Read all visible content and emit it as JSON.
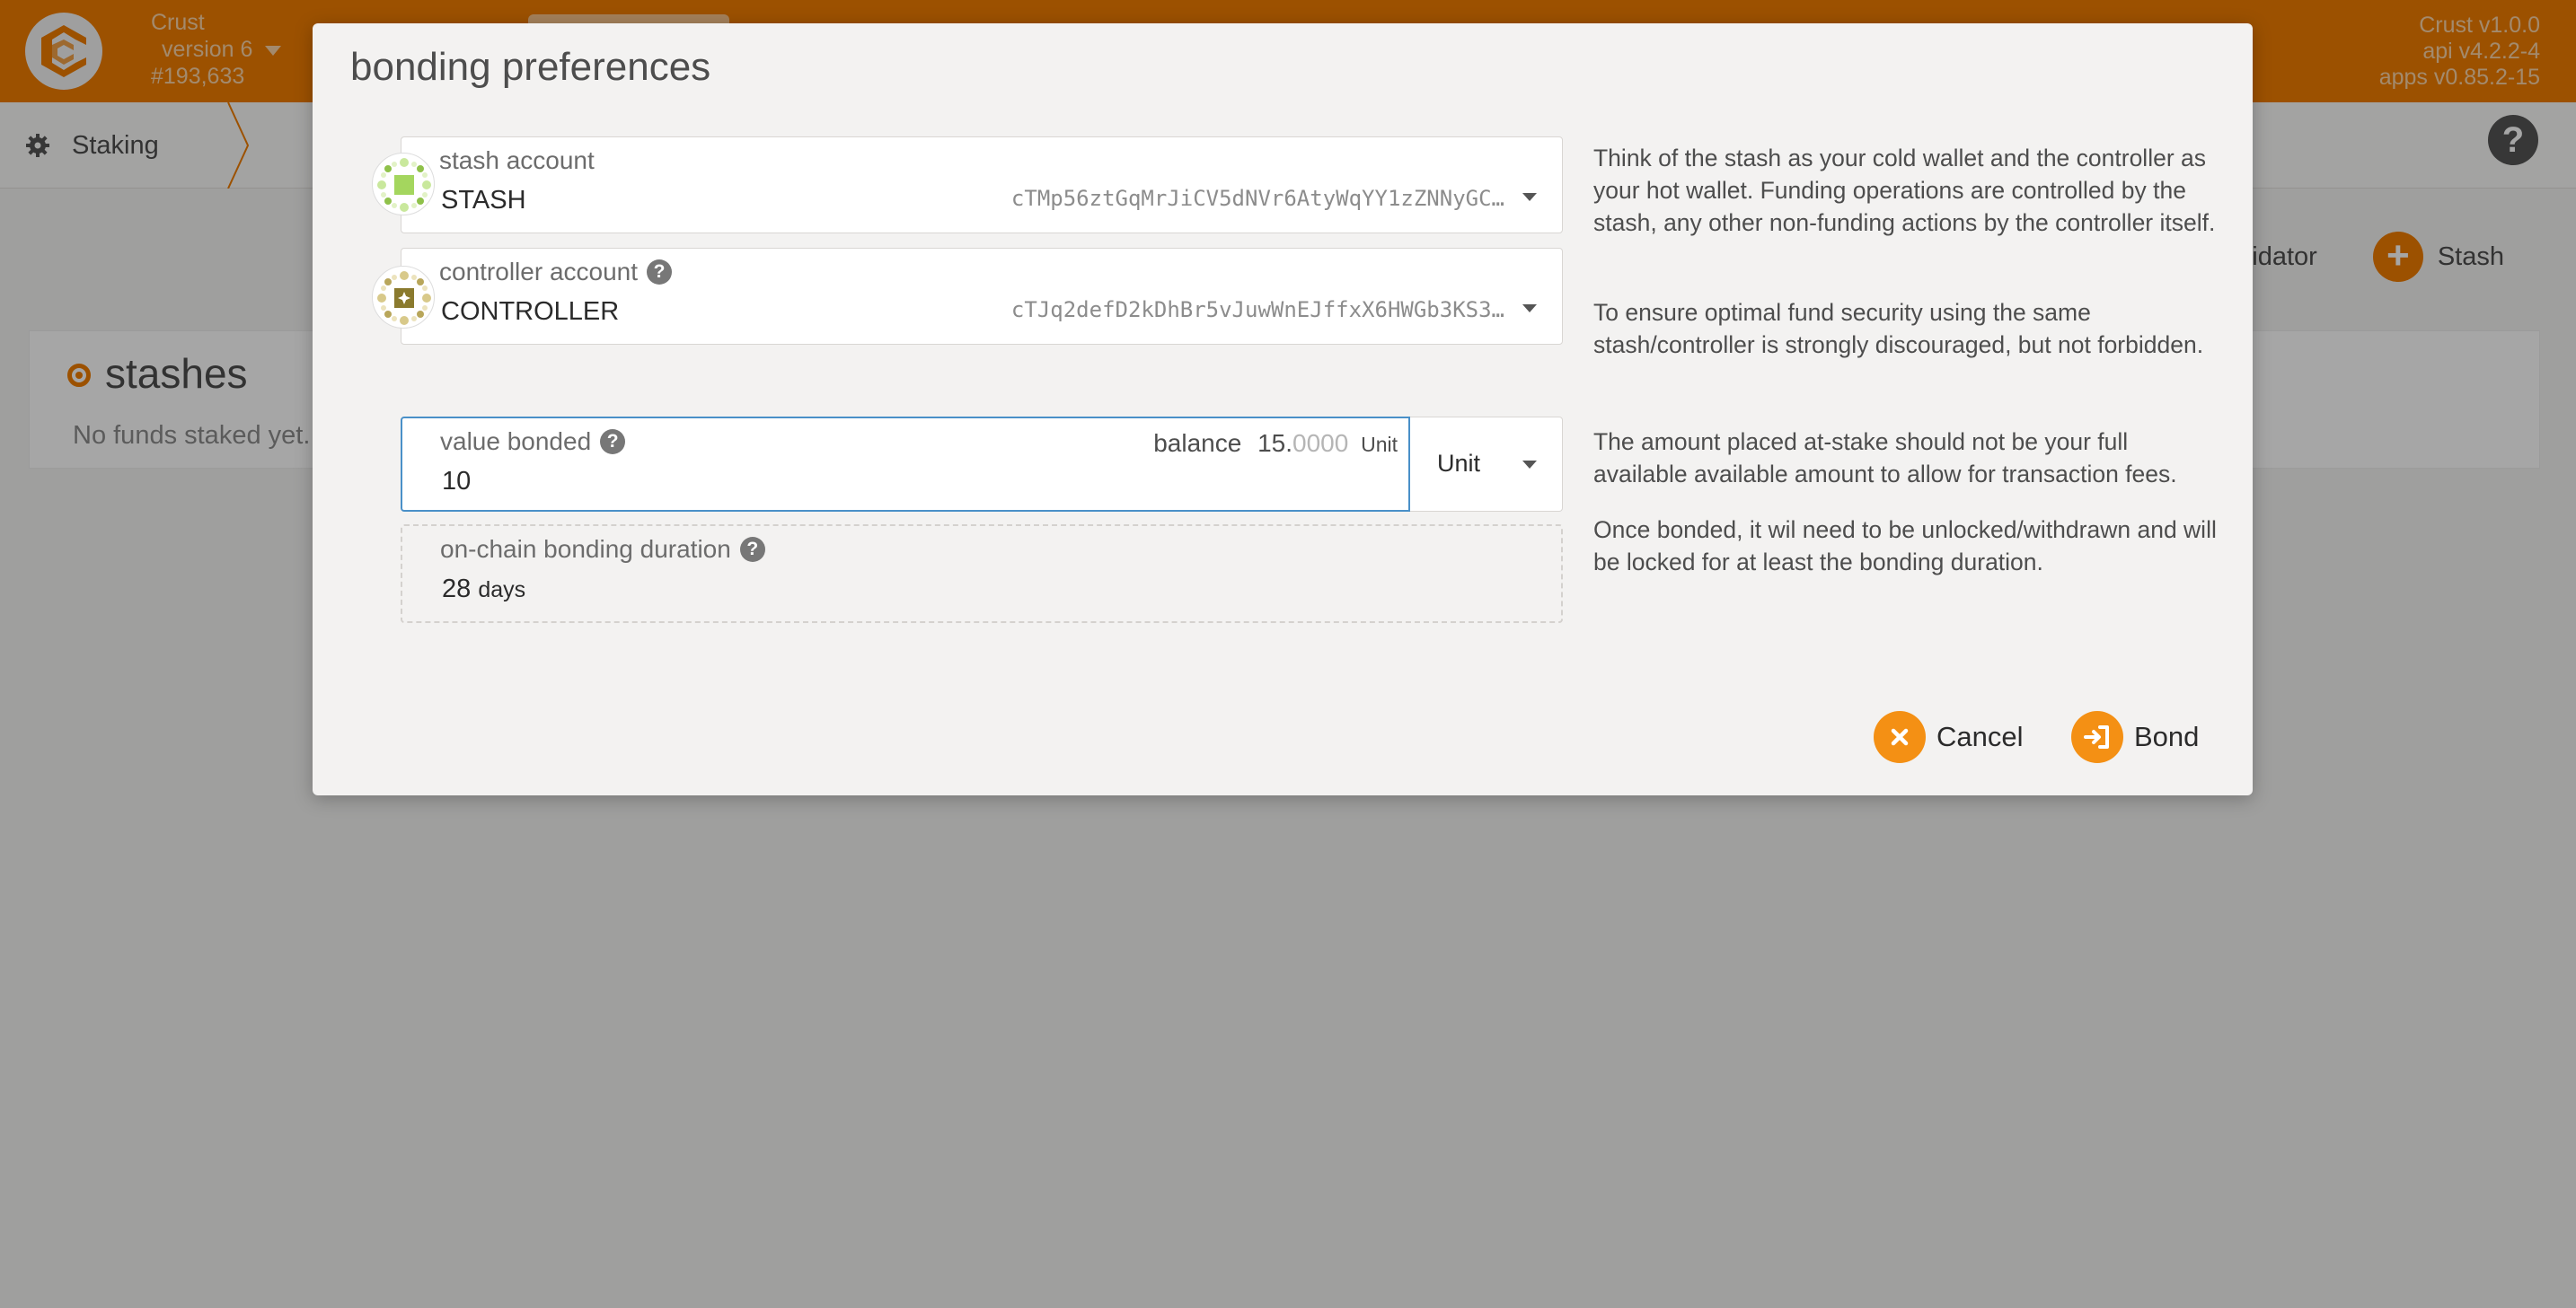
{
  "header": {
    "chain_name": "Crust",
    "version": "version 6",
    "block": "#193,633",
    "app_version": "Crust v1.0.0",
    "api_version": "api v4.2.2-4",
    "apps_version": "apps v0.85.2-15"
  },
  "nav": {
    "section": "Staking"
  },
  "actions": {
    "validator_label": "idator",
    "stash_label": "Stash"
  },
  "stashes": {
    "title": "stashes",
    "empty_text": "No funds staked yet."
  },
  "modal": {
    "title": "bonding preferences",
    "stash": {
      "label": "stash account",
      "name": "STASH",
      "address": "cTMp56ztGqMrJiCV5dNVr6AtyWqYY1zZNNyGC…"
    },
    "controller": {
      "label": "controller account",
      "name": "CONTROLLER",
      "address": "cTJq2defD2kDhBr5vJuwWnEJffxX6HWGb3KS3…"
    },
    "value_bonded": {
      "label": "value bonded",
      "value": "10",
      "balance_label": "balance",
      "balance_int": "15.",
      "balance_dec": "0000",
      "balance_unit": "Unit",
      "unit_selected": "Unit"
    },
    "duration": {
      "label": "on-chain bonding duration",
      "value": "28",
      "unit": "days"
    },
    "help": {
      "p1": "Think of the stash as your cold wallet and the controller as your hot wallet. Funding operations are controlled by the stash, any other non-funding actions by the controller itself.",
      "p2": "To ensure optimal fund security using the same stash/controller is strongly discouraged, but not forbidden.",
      "p3": "The amount placed at-stake should not be your full available available amount to allow for transaction fees.",
      "p4": "Once bonded, it wil need to be unlocked/withdrawn and will be locked for at least the bonding duration."
    },
    "buttons": {
      "cancel": "Cancel",
      "bond": "Bond"
    }
  },
  "colors": {
    "accent": "#f07d00",
    "button": "#f49014",
    "focus": "#4a90c8"
  },
  "icons": [
    "crust-logo-icon",
    "gear-icon",
    "help-icon",
    "plus-icon",
    "question-icon",
    "chevron-down-icon",
    "close-icon",
    "sign-in-icon"
  ]
}
